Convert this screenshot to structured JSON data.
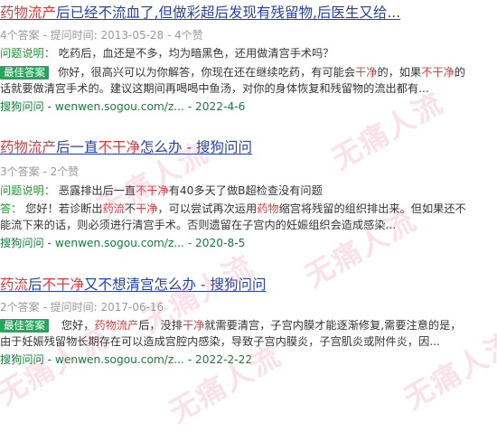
{
  "watermark_text": "无痛人流",
  "results": [
    {
      "title_parts": [
        {
          "t": "药物流产",
          "hl": true
        },
        {
          "t": "后已经不流血了,但做彩超后发现有残留物,后医生又给...",
          "hl": false
        }
      ],
      "meta": "4个答案 - 提问时间: 2013-05-28 - 4个赞",
      "question_label": "问题说明：",
      "question": " 吃药后，血还是不多，均为暗黑色，还用做清宫手术吗？",
      "best_label": "最佳答案",
      "answer_line1_parts": [
        {
          "t": "你好，很高兴可以为你解答，你现在还在继续吃药，有可能会",
          "hl": false
        },
        {
          "t": "干净",
          "hl": true
        },
        {
          "t": "的，如果",
          "hl": false
        },
        {
          "t": "不干净",
          "hl": true
        },
        {
          "t": "的",
          "hl": false
        }
      ],
      "answer_line2": "话就要做清宫手术的。建议这期间再喝喝中鱼汤，对你的身体恢复和残留物的流出都有...",
      "source": "搜狗问问 - wenwen.sogou.com/z... - 2022-4-6"
    },
    {
      "title_parts": [
        {
          "t": "药物流产",
          "hl": true
        },
        {
          "t": "后一直",
          "hl": false
        },
        {
          "t": "不干净",
          "hl": true
        },
        {
          "t": "怎么办 - 搜狗问问",
          "hl": false
        }
      ],
      "meta": "3个答案 - 2个赞",
      "question_label": "问题说明：",
      "question_parts": [
        {
          "t": " 恶露排出后一直",
          "hl": false
        },
        {
          "t": "不干净",
          "hl": true
        },
        {
          "t": "有40多天了做B超检查没有问题",
          "hl": false
        }
      ],
      "answer_label": "答：",
      "answer_line1_parts": [
        {
          "t": " 您好！若诊断出",
          "hl": false
        },
        {
          "t": "药流",
          "hl": true
        },
        {
          "t": "不",
          "hl": false
        },
        {
          "t": "干净",
          "hl": true
        },
        {
          "t": "，可以尝试再次运用",
          "hl": false
        },
        {
          "t": "药物",
          "hl": true
        },
        {
          "t": "缩宫将残留的组织排出来。但如果还不",
          "hl": false
        }
      ],
      "answer_line2": "能流下来的话，则必须进行清宫手术。否则遗留在子宫内的妊娠组织会造成感染...",
      "source": "搜狗问问 - wenwen.sogou.com/z... - 2020-8-5"
    },
    {
      "title_parts": [
        {
          "t": "药流",
          "hl": true
        },
        {
          "t": "后",
          "hl": false
        },
        {
          "t": "不干净",
          "hl": true
        },
        {
          "t": "又不想清宫怎么办 - 搜狗问问",
          "hl": false
        }
      ],
      "meta": "2个答案 - 提问时间: 2017-06-16",
      "best_label": "最佳答案",
      "answer_line1_parts": [
        {
          "t": " 您好，",
          "hl": false
        },
        {
          "t": "药物流产",
          "hl": true
        },
        {
          "t": "后，没排",
          "hl": false
        },
        {
          "t": "干净",
          "hl": true
        },
        {
          "t": "就需要清宫，子宫内膜才能逐渐修复,需要注意的是，",
          "hl": false
        }
      ],
      "answer_line2": "由于妊娠残留物长期存在可以造成宫腔内感染，导致子宫内膜炎，子宫肌炎或附件炎，因...",
      "source": "搜狗问问 - wenwen.sogou.com/z... - 2022-2-22"
    }
  ]
}
